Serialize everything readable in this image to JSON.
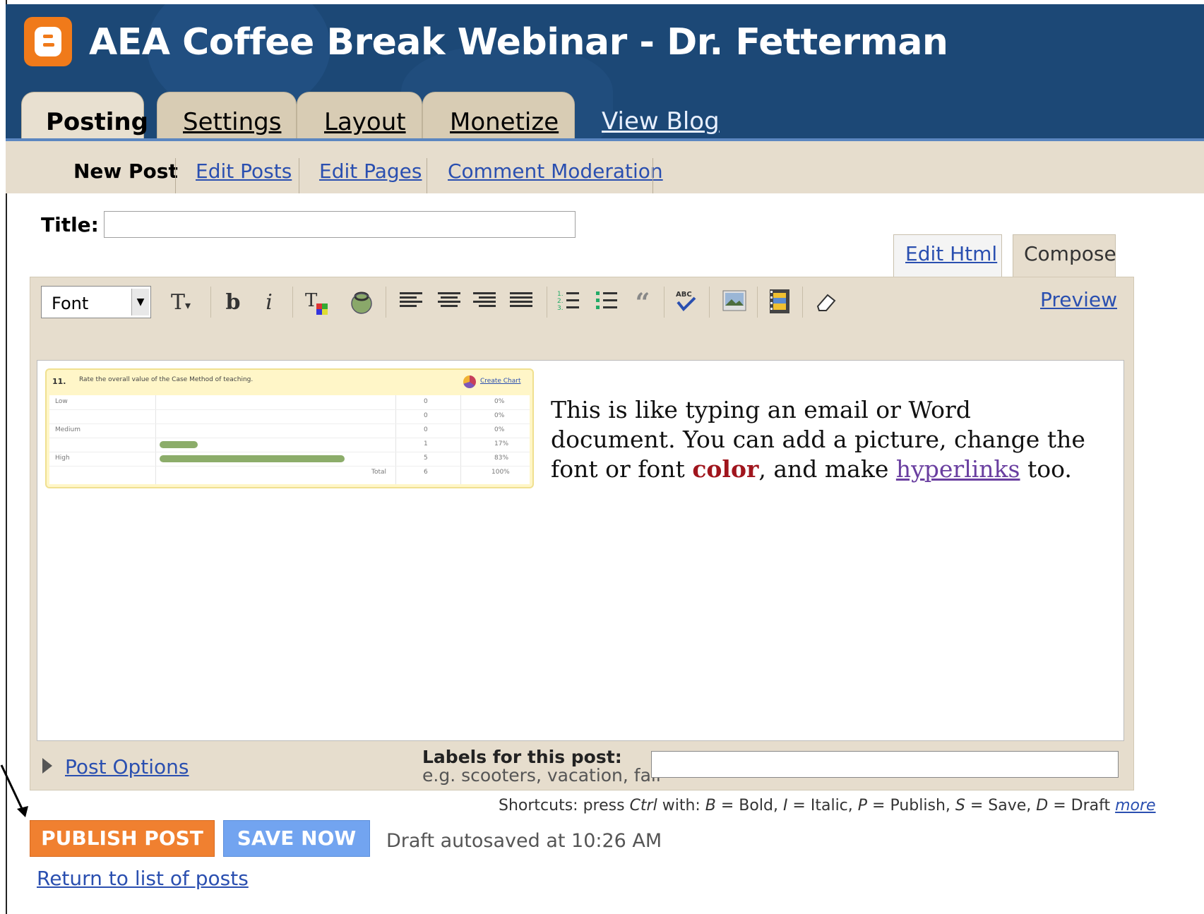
{
  "header": {
    "blog_title": "AEA Coffee Break Webinar - Dr. Fetterman"
  },
  "tabs": [
    {
      "label": "Posting",
      "active": true
    },
    {
      "label": "Settings"
    },
    {
      "label": "Layout"
    },
    {
      "label": "Monetize"
    }
  ],
  "view_blog": "View Blog",
  "subtabs": [
    {
      "label": "New Post",
      "active": true
    },
    {
      "label": "Edit Posts"
    },
    {
      "label": "Edit Pages"
    },
    {
      "label": "Comment Moderation"
    }
  ],
  "title_field": {
    "label": "Title:",
    "value": ""
  },
  "editor_modes": {
    "edit_html": "Edit Html",
    "compose": "Compose"
  },
  "toolbar": {
    "font_select": "Font",
    "icons": [
      "font-size-icon",
      "bold-icon",
      "italic-icon",
      "text-color-icon",
      "link-icon",
      "align-left-icon",
      "align-center-icon",
      "align-right-icon",
      "justify-icon",
      "numbered-list-icon",
      "bullet-list-icon",
      "blockquote-icon",
      "spellcheck-icon",
      "image-icon",
      "video-icon",
      "eraser-icon"
    ],
    "preview": "Preview"
  },
  "post_body": {
    "text_before": "This is like typing an email or Word document. You can add a picture, change the font or font ",
    "colored_word": "color",
    "text_middle": ", and make ",
    "link_word": "hyperlinks",
    "text_after": " too."
  },
  "embedded_image": {
    "question_number": "11.",
    "question": "Rate the overall value of the Case Method of teaching.",
    "create_chart": "Create Chart",
    "rows": [
      {
        "label": "Low",
        "count": "0",
        "percent": "0%",
        "fraction": 0
      },
      {
        "label": "",
        "count": "0",
        "percent": "0%",
        "fraction": 0
      },
      {
        "label": "Medium",
        "count": "0",
        "percent": "0%",
        "fraction": 0
      },
      {
        "label": "",
        "count": "1",
        "percent": "17%",
        "fraction": 0.17
      },
      {
        "label": "High",
        "count": "5",
        "percent": "83%",
        "fraction": 0.83
      }
    ],
    "total": {
      "label": "Total",
      "count": "6",
      "percent": "100%"
    }
  },
  "post_options": "Post Options",
  "labels": {
    "title": "Labels for this post:",
    "hint": "e.g. scooters, vacation, fall",
    "value": ""
  },
  "shortcuts": {
    "prefix": "Shortcuts: press ",
    "ctrl": "Ctrl",
    "with": " with: ",
    "b": "B",
    "b_text": " = Bold, ",
    "i": "I",
    "i_text": " = Italic, ",
    "p": "P",
    "p_text": " = Publish, ",
    "s": "S",
    "s_text": " = Save, ",
    "d": "D",
    "d_text": " = Draft ",
    "more": "more"
  },
  "actions": {
    "publish": "PUBLISH POST",
    "save": "SAVE NOW"
  },
  "autosave_status": "Draft autosaved at 10:26 AM",
  "return_link": "Return to list of posts",
  "colors": {
    "header": "#1c4876",
    "publish": "#f08030",
    "save": "#72a4f0",
    "link": "#2a4fb0"
  }
}
